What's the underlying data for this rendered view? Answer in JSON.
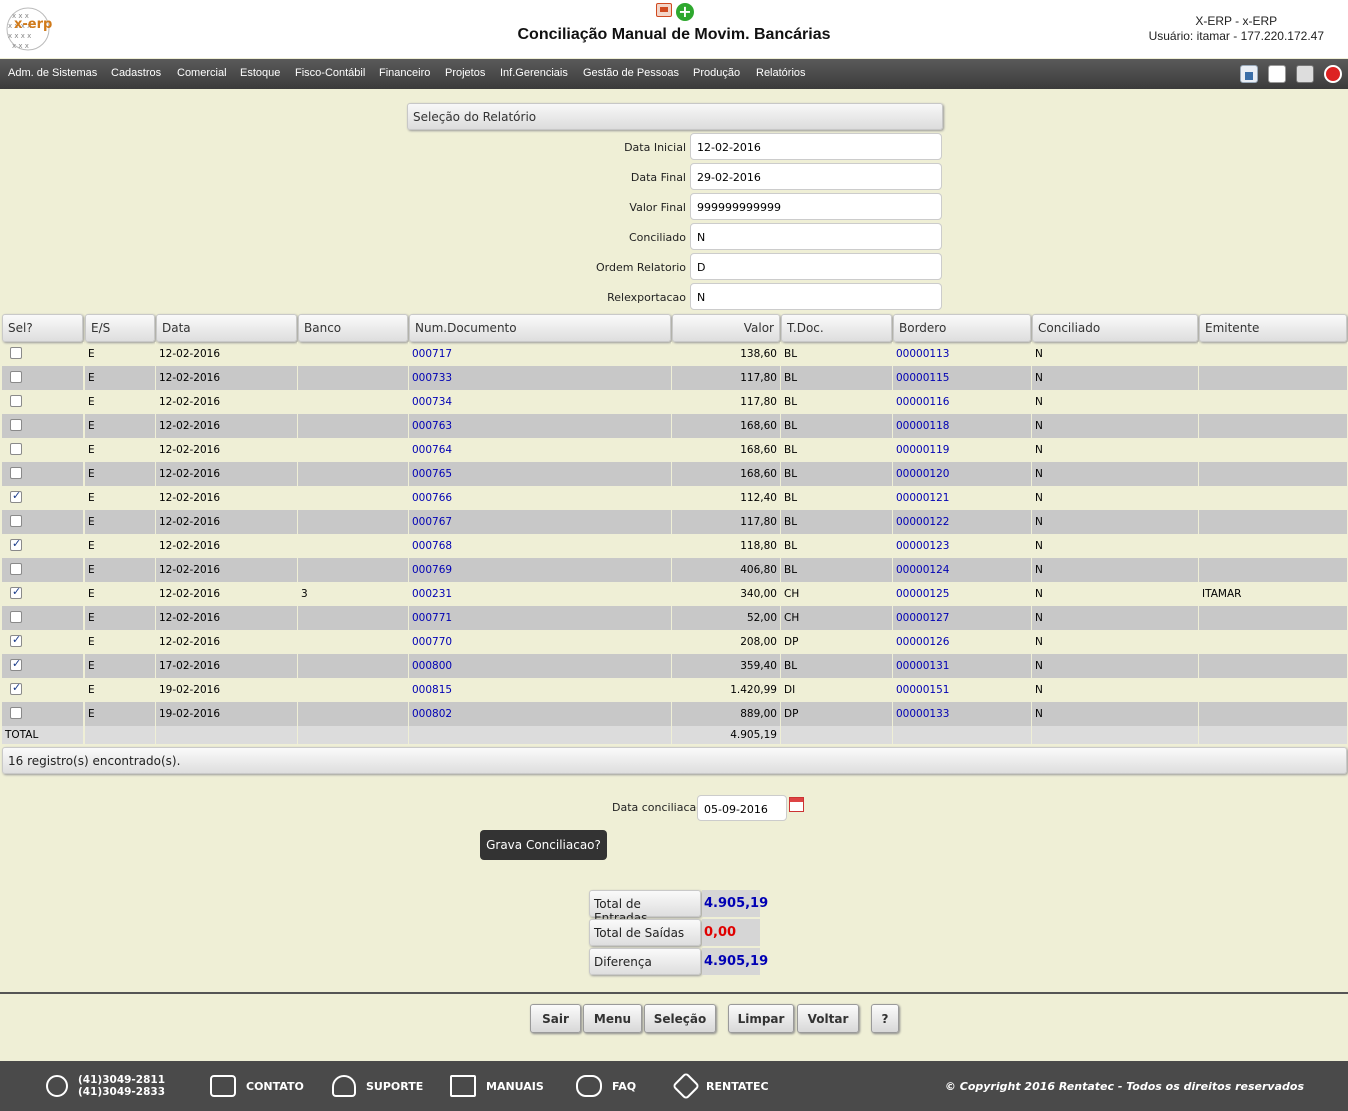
{
  "header": {
    "logo_text": "x-erp",
    "title": "Conciliação Manual de Movim. Bancárias",
    "user_line1": "X-ERP - x-ERP",
    "user_line2": "Usuário: itamar - 177.220.172.47",
    "add_icon": "+"
  },
  "nav": {
    "items": [
      "Adm. de Sistemas",
      "Cadastros",
      "Comercial",
      "Estoque",
      "Fisco-Contábil",
      "Financeiro",
      "Projetos",
      "Inf.Gerenciais",
      "Gestão de Pessoas",
      "Produção",
      "Relatórios"
    ]
  },
  "selection": {
    "title": "Seleção do Relatório",
    "fields": [
      {
        "label": "Data Inicial",
        "value": "12-02-2016"
      },
      {
        "label": "Data Final",
        "value": "29-02-2016"
      },
      {
        "label": "Valor Final",
        "value": "999999999999"
      },
      {
        "label": "Conciliado",
        "value": "N"
      },
      {
        "label": "Ordem Relatorio",
        "value": "D"
      },
      {
        "label": "Relexportacao",
        "value": "N"
      }
    ]
  },
  "table": {
    "headers": [
      "Sel?",
      "E/S",
      "Data",
      "Banco",
      "Num.Documento",
      "Valor",
      "T.Doc.",
      "Bordero",
      "Conciliado",
      "Emitente"
    ],
    "rows": [
      {
        "sel": false,
        "es": "E",
        "data": "12-02-2016",
        "banco": "",
        "doc": "000717",
        "valor": "138,60",
        "tdoc": "BL",
        "bordero": "00000113",
        "conc": "N",
        "emit": ""
      },
      {
        "sel": false,
        "es": "E",
        "data": "12-02-2016",
        "banco": "",
        "doc": "000733",
        "valor": "117,80",
        "tdoc": "BL",
        "bordero": "00000115",
        "conc": "N",
        "emit": ""
      },
      {
        "sel": false,
        "es": "E",
        "data": "12-02-2016",
        "banco": "",
        "doc": "000734",
        "valor": "117,80",
        "tdoc": "BL",
        "bordero": "00000116",
        "conc": "N",
        "emit": ""
      },
      {
        "sel": false,
        "es": "E",
        "data": "12-02-2016",
        "banco": "",
        "doc": "000763",
        "valor": "168,60",
        "tdoc": "BL",
        "bordero": "00000118",
        "conc": "N",
        "emit": ""
      },
      {
        "sel": false,
        "es": "E",
        "data": "12-02-2016",
        "banco": "",
        "doc": "000764",
        "valor": "168,60",
        "tdoc": "BL",
        "bordero": "00000119",
        "conc": "N",
        "emit": ""
      },
      {
        "sel": false,
        "es": "E",
        "data": "12-02-2016",
        "banco": "",
        "doc": "000765",
        "valor": "168,60",
        "tdoc": "BL",
        "bordero": "00000120",
        "conc": "N",
        "emit": ""
      },
      {
        "sel": true,
        "es": "E",
        "data": "12-02-2016",
        "banco": "",
        "doc": "000766",
        "valor": "112,40",
        "tdoc": "BL",
        "bordero": "00000121",
        "conc": "N",
        "emit": ""
      },
      {
        "sel": false,
        "es": "E",
        "data": "12-02-2016",
        "banco": "",
        "doc": "000767",
        "valor": "117,80",
        "tdoc": "BL",
        "bordero": "00000122",
        "conc": "N",
        "emit": ""
      },
      {
        "sel": true,
        "es": "E",
        "data": "12-02-2016",
        "banco": "",
        "doc": "000768",
        "valor": "118,80",
        "tdoc": "BL",
        "bordero": "00000123",
        "conc": "N",
        "emit": ""
      },
      {
        "sel": false,
        "es": "E",
        "data": "12-02-2016",
        "banco": "",
        "doc": "000769",
        "valor": "406,80",
        "tdoc": "BL",
        "bordero": "00000124",
        "conc": "N",
        "emit": ""
      },
      {
        "sel": true,
        "es": "E",
        "data": "12-02-2016",
        "banco": "3",
        "doc": "000231",
        "valor": "340,00",
        "tdoc": "CH",
        "bordero": "00000125",
        "conc": "N",
        "emit": "ITAMAR"
      },
      {
        "sel": false,
        "es": "E",
        "data": "12-02-2016",
        "banco": "",
        "doc": "000771",
        "valor": "52,00",
        "tdoc": "CH",
        "bordero": "00000127",
        "conc": "N",
        "emit": ""
      },
      {
        "sel": true,
        "es": "E",
        "data": "12-02-2016",
        "banco": "",
        "doc": "000770",
        "valor": "208,00",
        "tdoc": "DP",
        "bordero": "00000126",
        "conc": "N",
        "emit": ""
      },
      {
        "sel": true,
        "es": "E",
        "data": "17-02-2016",
        "banco": "",
        "doc": "000800",
        "valor": "359,40",
        "tdoc": "BL",
        "bordero": "00000131",
        "conc": "N",
        "emit": ""
      },
      {
        "sel": true,
        "es": "E",
        "data": "19-02-2016",
        "banco": "",
        "doc": "000815",
        "valor": "1.420,99",
        "tdoc": "DI",
        "bordero": "00000151",
        "conc": "N",
        "emit": ""
      },
      {
        "sel": false,
        "es": "E",
        "data": "19-02-2016",
        "banco": "",
        "doc": "000802",
        "valor": "889,00",
        "tdoc": "DP",
        "bordero": "00000133",
        "conc": "N",
        "emit": ""
      }
    ],
    "total_label": "TOTAL",
    "total_value": "4.905,19",
    "count_text": "16 registro(s) encontrado(s)."
  },
  "conciliation": {
    "date_label": "Data conciliacao",
    "date_value": "05-09-2016",
    "save_label": "Grava Conciliacao?"
  },
  "totals": [
    {
      "label": "Total de Entradas",
      "value": "4.905,19",
      "color": "#0000b4"
    },
    {
      "label": "Total de Saídas",
      "value": "0,00",
      "color": "#e00000"
    },
    {
      "label": "Diferença",
      "value": "4.905,19",
      "color": "#0000b4"
    }
  ],
  "buttons": [
    "Sair",
    "Menu",
    "Seleção",
    "Limpar",
    "Voltar",
    "?"
  ],
  "footer": {
    "phone1": "(41)3049-2811",
    "phone2": "(41)3049-2833",
    "links": [
      "CONTATO",
      "SUPORTE",
      "MANUAIS",
      "FAQ",
      "RENTATEC"
    ],
    "copyright": "© Copyright 2016 Rentatec - Todos os direitos reservados"
  }
}
